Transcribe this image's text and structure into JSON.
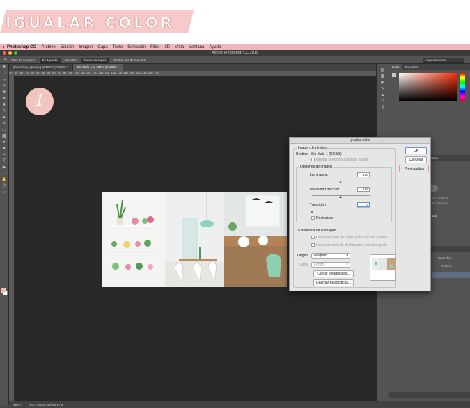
{
  "banner": {
    "title": "IGUALAR COLOR"
  },
  "step_badge": "1",
  "menubar": {
    "app": "Photoshop CC",
    "items": [
      "Archivo",
      "Edición",
      "Imagen",
      "Capa",
      "Texto",
      "Selección",
      "Filtro",
      "3D",
      "Vista",
      "Ventana",
      "Ayuda"
    ]
  },
  "window": {
    "title": "Adobe Photoshop CC 2015"
  },
  "options_bar": {
    "sample_label": "Tam. de muestra:",
    "sample_value": "De 1 punto",
    "sample2_label": "Muestra:",
    "sample2_value": "Todas las capas",
    "ring_label": "Mostrar aro de muestra",
    "workspace": "Aspectos esen."
  },
  "tabs": [
    {
      "label": "photoshop_tips2.jpg al 100% (RGB/8) *"
    },
    {
      "label": "Sin título-1 al 100% (RGB/8) *"
    }
  ],
  "ruler_ticks": "40   50   60   10   20   30   40   50   60   70   80   90   100  110  120  130  140  150  160  170  180  190  200  210  220  230",
  "status": {
    "zoom": "100%",
    "doc": "Doc: 682,1 KB/682,1 KB"
  },
  "panel": {
    "tabs": [
      "Color",
      "Muestras"
    ],
    "tabs2": [
      "Bibliotecas",
      "Ajustes",
      "Estilos"
    ],
    "lib_text_1": "...ncias Creativa",
    "lib_text_2": "...al de Creative",
    "lib_link": "...ahora",
    "opacity_label": "Opacidad:",
    "fill_label": "Relleno:"
  },
  "dialog": {
    "title": "Igualar color",
    "target_group": "Imagen de destino",
    "destino_label": "Destino:",
    "destino_value": "Sin título-1 (RGB/8)",
    "ignore_label": "Ignorar selección al aplicar ajuste",
    "options_group": "Opciones de imagen",
    "luminancia_label": "Luminancia",
    "luminancia_value": "100",
    "intensidad_label": "Intensidad de color",
    "intensidad_value": "100",
    "transicion_label": "Transición",
    "transicion_value": "0",
    "neutralizar_label": "Neutralizar",
    "stats_group": "Estadística de la imagen",
    "stats_origin_label": "Usar selección de origen para calcular colores",
    "stats_target_label": "Usar selección de destino para calcular ajuste",
    "origen_label": "Origen:",
    "origen_value": "Ninguno",
    "capa_label": "Capa:",
    "capa_value": "Fondo",
    "load_button": "Cargar estadísticas...",
    "save_button": "Guardar estadísticas...",
    "ok_button": "OK",
    "cancel_button": "Cancelar",
    "preview_label": "Previsualizar"
  },
  "colors": {
    "accent_pink": "#f2c4c0",
    "menubar_pink": "#f0b8bc",
    "canvas": "#282828",
    "panel": "#535353"
  }
}
